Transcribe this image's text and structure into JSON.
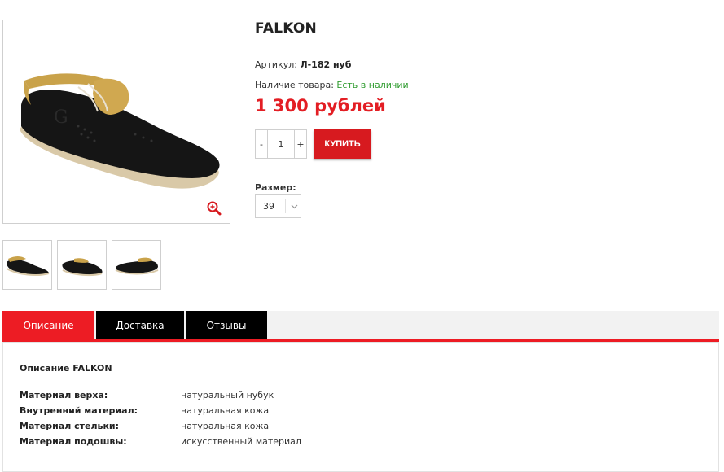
{
  "product": {
    "title": "FALKON",
    "sku_label": "Артикул:",
    "sku_value": "Л-182 нуб",
    "availability_label": "Наличие товара:",
    "availability_value": "Есть в наличии",
    "price": "1 300 рублей",
    "quantity": "1",
    "minus_label": "-",
    "plus_label": "+",
    "buy_label": "КУПИТЬ",
    "size_label": "Размер:",
    "size_value": "39"
  },
  "gallery": {
    "zoom_icon": "zoom-in-icon",
    "thumbnails": [
      "shoe-thumbnail-1",
      "shoe-thumbnail-2",
      "shoe-thumbnail-3"
    ]
  },
  "tabs": [
    {
      "label": "Описание",
      "active": true
    },
    {
      "label": "Доставка",
      "active": false
    },
    {
      "label": "Отзывы",
      "active": false
    }
  ],
  "description": {
    "title": "Описание FALKON",
    "specs": [
      {
        "key": "Материал верха:",
        "value": "натуральный нубук"
      },
      {
        "key": "Внутренний материал:",
        "value": "натуральная кожа"
      },
      {
        "key": "Материал стельки:",
        "value": "натуральная кожа"
      },
      {
        "key": "Материал подошвы:",
        "value": "искусственный материал"
      }
    ]
  },
  "colors": {
    "accent": "#ed1c24",
    "buy_button": "#d71a1f",
    "price": "#e31e24",
    "in_stock": "#2e9b2e",
    "tab_inactive": "#000000"
  }
}
